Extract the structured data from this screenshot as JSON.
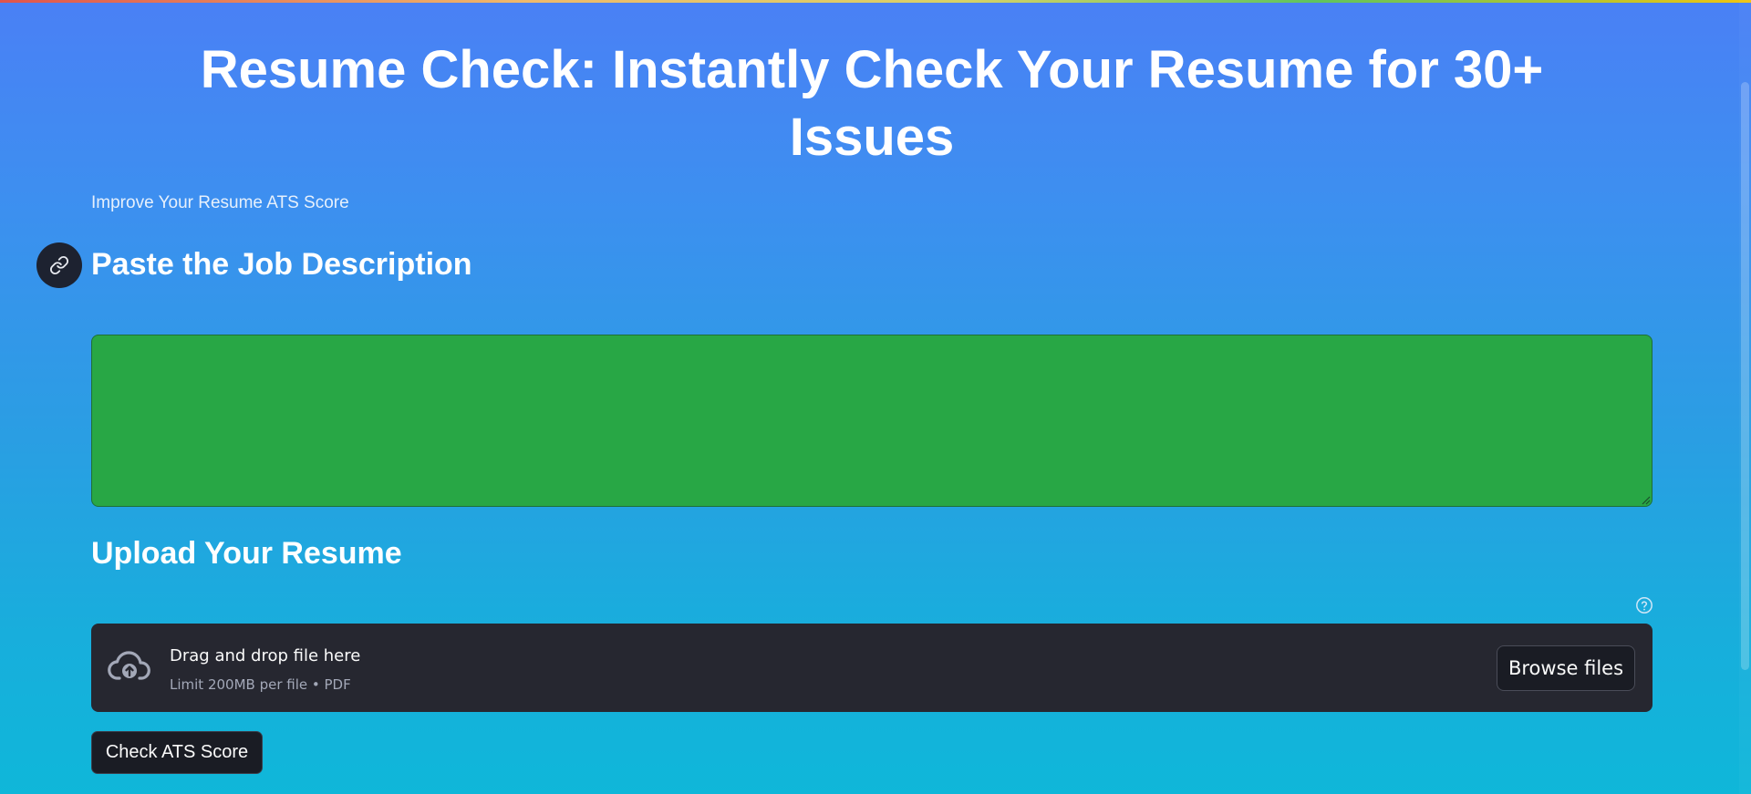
{
  "page": {
    "title": "Resume Check: Instantly Check Your Resume for 30+ Issues",
    "subtitle": "Improve Your Resume ATS Score"
  },
  "job_description": {
    "heading": "Paste the Job Description",
    "anchor_icon": "link-icon",
    "textarea_value": "",
    "textarea_color": "#28a745"
  },
  "upload": {
    "heading": "Upload Your Resume",
    "help_icon": "question-circle-icon",
    "dropzone": {
      "icon": "cloud-upload-icon",
      "label": "Drag and drop file here",
      "limit_text": "Limit 200MB per file • PDF",
      "browse_label": "Browse files",
      "background": "#262730"
    }
  },
  "actions": {
    "check_label": "Check ATS Score"
  },
  "colors": {
    "gradient_top": "#4a80f5",
    "gradient_bottom": "#0fb7d9",
    "button_dark": "#1a1c24"
  }
}
